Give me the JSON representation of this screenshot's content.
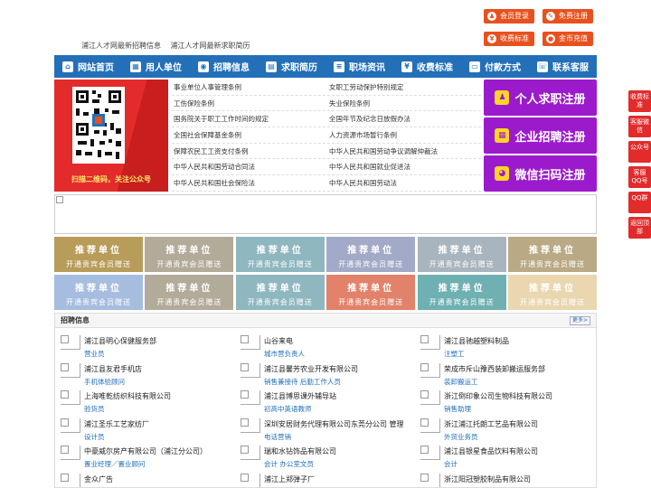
{
  "top_buttons": [
    {
      "label": "会员登录",
      "icon": "user-icon"
    },
    {
      "label": "免费注册",
      "icon": "edit-icon"
    },
    {
      "label": "收费标准",
      "icon": "tag-icon"
    },
    {
      "label": "金币充值",
      "icon": "coin-icon"
    }
  ],
  "tagline": [
    "浦江人才网最新招聘信息",
    "浦江人才网最新求职简历"
  ],
  "nav": [
    {
      "label": "网站首页",
      "icon": "home-icon"
    },
    {
      "label": "用人单位",
      "icon": "building-icon"
    },
    {
      "label": "招聘信息",
      "icon": "broadcast-icon"
    },
    {
      "label": "求职简历",
      "icon": "document-icon"
    },
    {
      "label": "职场资讯",
      "icon": "list-icon"
    },
    {
      "label": "收费标准",
      "icon": "price-icon"
    },
    {
      "label": "付款方式",
      "icon": "payment-icon"
    },
    {
      "label": "联系客服",
      "icon": "phone-icon"
    }
  ],
  "qr_caption": "扫描二维码，关注公众号",
  "policy_links_left": [
    "事业单位人事管理条例",
    "工伤保险条例",
    "国务院关于职工工作时间的规定",
    "全国社会保障基金条例",
    "保障农民工工资支付条例",
    "中华人民共和国劳动合同法",
    "中华人民共和国社会保险法"
  ],
  "policy_links_right": [
    "女职工劳动保护特别规定",
    "失业保险条例",
    "全国年节及纪念日放假办法",
    "人力资源市场暂行条例",
    "中华人民共和国劳动争议调解仲裁法",
    "中华人民共和国就业促进法",
    "中华人民共和国劳动法"
  ],
  "register_buttons": [
    {
      "label": "个人求职注册",
      "icon": "person-icon"
    },
    {
      "label": "企业招聘注册",
      "icon": "company-icon"
    },
    {
      "label": "微信扫码注册",
      "icon": "wechat-icon"
    }
  ],
  "recommend": {
    "title": "推荐单位",
    "subtitle": "开通贵宾会员赠送",
    "colors": [
      "#b89c5a",
      "#b3ab99",
      "#8fb7c0",
      "#a3aac8",
      "#a9b5be",
      "#b9aa85",
      "#a6bde0",
      "#b3ab99",
      "#8fb7c0",
      "#e2826a",
      "#6fb0b2",
      "#ead7b0"
    ]
  },
  "jobs_section": {
    "title": "招聘信息",
    "more": "更多>"
  },
  "jobs": [
    [
      {
        "company": "浦江县明心保健服务部",
        "position": "营业员"
      },
      {
        "company": "山谷来电",
        "position": "城市营负责人"
      },
      {
        "company": "浦江县驰越塑料制品",
        "position": "注塑工"
      }
    ],
    [
      {
        "company": "浦江县友君手机店",
        "position": "手机体验顾问"
      },
      {
        "company": "浦江县馨芳农业开发有限公司",
        "position": "销售兼接待 后勤工作人员"
      },
      {
        "company": "荣成市斥山豫西装卸搬运服务部",
        "position": "装卸搬运工"
      }
    ],
    [
      {
        "company": "上海唯乾纺织科技有限公司",
        "position": "验货员"
      },
      {
        "company": "浦江县博思课外辅导站",
        "position": "初高中英语教师"
      },
      {
        "company": "浙江倒印象公司生物科技有限公司",
        "position": "销售助理"
      }
    ],
    [
      {
        "company": "浦江圣乐工艺家纺厂",
        "position": "设计员"
      },
      {
        "company": "深圳安居财务代理有限公司东莞分公司 管理",
        "position": "电话营销"
      },
      {
        "company": "浙江浦江托朗工艺品有限公司",
        "position": "外贸业务员"
      }
    ],
    [
      {
        "company": "中豪威尔房产有限公司（浦江分公司）",
        "position": "置业经理／置业顾问"
      },
      {
        "company": "瑞和水钻饰品有限公司",
        "position": "会计 办公室文员"
      },
      {
        "company": "浦江县银星食品饮料有限公司",
        "position": "会计"
      }
    ],
    [
      {
        "company": "金众广告",
        "position": "电视广告策划 电视广告策划\\ 业务员"
      },
      {
        "company": "浦江上郑弹子厂",
        "position": "仓库管理"
      },
      {
        "company": "浙江阳冠塑胶制品有限公司",
        "position": "营业员 文员 统计"
      }
    ]
  ],
  "side_buttons": [
    "收费标准",
    "客服微信",
    "公众号",
    "客服QQ号",
    "QQ群",
    "返回顶部"
  ]
}
